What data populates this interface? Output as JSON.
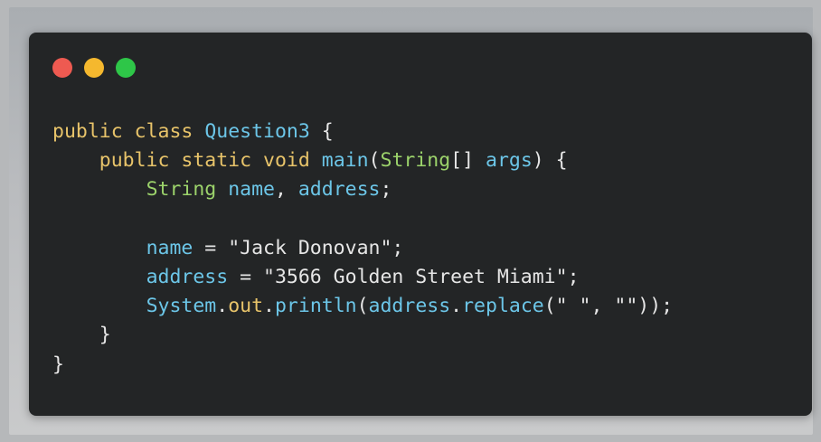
{
  "window": {
    "controls": {
      "close_color": "#ee5a51",
      "minimize_color": "#f5b82e",
      "maximize_color": "#2ec648"
    }
  },
  "code": {
    "lines": [
      {
        "indent": "",
        "tokens": [
          {
            "t": "public",
            "c": "kw"
          },
          {
            "t": " ",
            "c": "punc"
          },
          {
            "t": "class",
            "c": "kw"
          },
          {
            "t": " ",
            "c": "punc"
          },
          {
            "t": "Question3",
            "c": "cls"
          },
          {
            "t": " {",
            "c": "punc"
          }
        ]
      },
      {
        "indent": "    ",
        "tokens": [
          {
            "t": "public",
            "c": "kw"
          },
          {
            "t": " ",
            "c": "punc"
          },
          {
            "t": "static",
            "c": "kw"
          },
          {
            "t": " ",
            "c": "punc"
          },
          {
            "t": "void",
            "c": "kw"
          },
          {
            "t": " ",
            "c": "punc"
          },
          {
            "t": "main",
            "c": "fn"
          },
          {
            "t": "(",
            "c": "punc"
          },
          {
            "t": "String",
            "c": "type"
          },
          {
            "t": "[] ",
            "c": "punc"
          },
          {
            "t": "args",
            "c": "ident"
          },
          {
            "t": ") {",
            "c": "punc"
          }
        ]
      },
      {
        "indent": "        ",
        "tokens": [
          {
            "t": "String",
            "c": "type"
          },
          {
            "t": " ",
            "c": "punc"
          },
          {
            "t": "name",
            "c": "ident"
          },
          {
            "t": ", ",
            "c": "punc"
          },
          {
            "t": "address",
            "c": "ident"
          },
          {
            "t": ";",
            "c": "punc"
          }
        ]
      },
      {
        "indent": "",
        "tokens": []
      },
      {
        "indent": "        ",
        "tokens": [
          {
            "t": "name",
            "c": "ident"
          },
          {
            "t": " = ",
            "c": "punc"
          },
          {
            "t": "\"Jack Donovan\"",
            "c": "str"
          },
          {
            "t": ";",
            "c": "punc"
          }
        ]
      },
      {
        "indent": "        ",
        "tokens": [
          {
            "t": "address",
            "c": "ident"
          },
          {
            "t": " = ",
            "c": "punc"
          },
          {
            "t": "\"3566 Golden Street Miami\"",
            "c": "str"
          },
          {
            "t": ";",
            "c": "punc"
          }
        ]
      },
      {
        "indent": "        ",
        "tokens": [
          {
            "t": "System",
            "c": "ident"
          },
          {
            "t": ".",
            "c": "punc"
          },
          {
            "t": "out",
            "c": "field"
          },
          {
            "t": ".",
            "c": "punc"
          },
          {
            "t": "println",
            "c": "fn"
          },
          {
            "t": "(",
            "c": "punc"
          },
          {
            "t": "address",
            "c": "ident"
          },
          {
            "t": ".",
            "c": "punc"
          },
          {
            "t": "replace",
            "c": "fn"
          },
          {
            "t": "(",
            "c": "punc"
          },
          {
            "t": "\" \"",
            "c": "str"
          },
          {
            "t": ", ",
            "c": "punc"
          },
          {
            "t": "\"\"",
            "c": "str"
          },
          {
            "t": "));",
            "c": "punc"
          }
        ]
      },
      {
        "indent": "    ",
        "tokens": [
          {
            "t": "}",
            "c": "punc"
          }
        ]
      },
      {
        "indent": "",
        "tokens": [
          {
            "t": "}",
            "c": "punc"
          }
        ]
      }
    ]
  }
}
